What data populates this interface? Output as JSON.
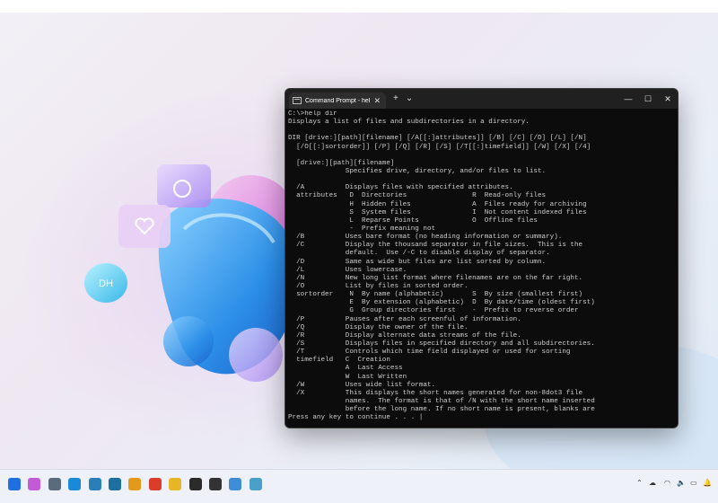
{
  "window": {
    "tab_title": "Command Prompt - help  dir",
    "tab_close": "✕",
    "new_tab": "+",
    "dropdown": "⌄",
    "minimize": "—",
    "maximize": "☐",
    "close": "✕"
  },
  "console_lines": [
    "C:\\>help dir",
    "Displays a list of files and subdirectories in a directory.",
    "",
    "DIR [drive:][path][filename] [/A[[:]attributes]] [/B] [/C] [/D] [/L] [/N]",
    "  [/O[[:]sortorder]] [/P] [/Q] [/R] [/S] [/T[[:]timefield]] [/W] [/X] [/4]",
    "",
    "  [drive:][path][filename]",
    "              Specifies drive, directory, and/or files to list.",
    "",
    "  /A          Displays files with specified attributes.",
    "  attributes   D  Directories                R  Read-only files",
    "               H  Hidden files               A  Files ready for archiving",
    "               S  System files               I  Not content indexed files",
    "               L  Reparse Points             O  Offline files",
    "               -  Prefix meaning not",
    "  /B          Uses bare format (no heading information or summary).",
    "  /C          Display the thousand separator in file sizes.  This is the",
    "              default.  Use /-C to disable display of separator.",
    "  /D          Same as wide but files are list sorted by column.",
    "  /L          Uses lowercase.",
    "  /N          New long list format where filenames are on the far right.",
    "  /O          List by files in sorted order.",
    "  sortorder    N  By name (alphabetic)       S  By size (smallest first)",
    "               E  By extension (alphabetic)  D  By date/time (oldest first)",
    "               G  Group directories first    -  Prefix to reverse order",
    "  /P          Pauses after each screenful of information.",
    "  /Q          Display the owner of the file.",
    "  /R          Display alternate data streams of the file.",
    "  /S          Displays files in specified directory and all subdirectories.",
    "  /T          Controls which time field displayed or used for sorting",
    "  timefield   C  Creation",
    "              A  Last Access",
    "              W  Last Written",
    "  /W          Uses wide list format.",
    "  /X          This displays the short names generated for non-8dot3 file",
    "              names.  The format is that of /N with the short name inserted",
    "              before the long name. If no short name is present, blanks are",
    "Press any key to continue . . . |"
  ],
  "desktop": {
    "badge_text": "DH"
  },
  "taskbar": {
    "icons": [
      {
        "name": "windows-start-icon",
        "color": "#1f6fe0"
      },
      {
        "name": "copilot-icon",
        "color": "#c35ad6"
      },
      {
        "name": "settings-icon",
        "color": "#5b6b7e"
      },
      {
        "name": "edge-icon",
        "color": "#1b8ad6"
      },
      {
        "name": "edge-beta-icon",
        "color": "#2a7fb8"
      },
      {
        "name": "edge-dev-icon",
        "color": "#1d6fa0"
      },
      {
        "name": "edge-canary-icon",
        "color": "#e39a1a"
      },
      {
        "name": "chrome-icon",
        "color": "#dc3d2a"
      },
      {
        "name": "file-explorer-icon",
        "color": "#e8b526"
      },
      {
        "name": "terminal-icon",
        "color": "#2b2b2b"
      },
      {
        "name": "chatgpt-icon",
        "color": "#333333"
      },
      {
        "name": "notepad-icon",
        "color": "#3d8ed6"
      },
      {
        "name": "remote-desktop-icon",
        "color": "#4aa0c8"
      }
    ],
    "tray": {
      "chevron": "⌃",
      "cloud": "☁",
      "language": "",
      "wifi": "◠",
      "volume": "🔈",
      "battery": "▭",
      "bell": "🔔"
    }
  }
}
